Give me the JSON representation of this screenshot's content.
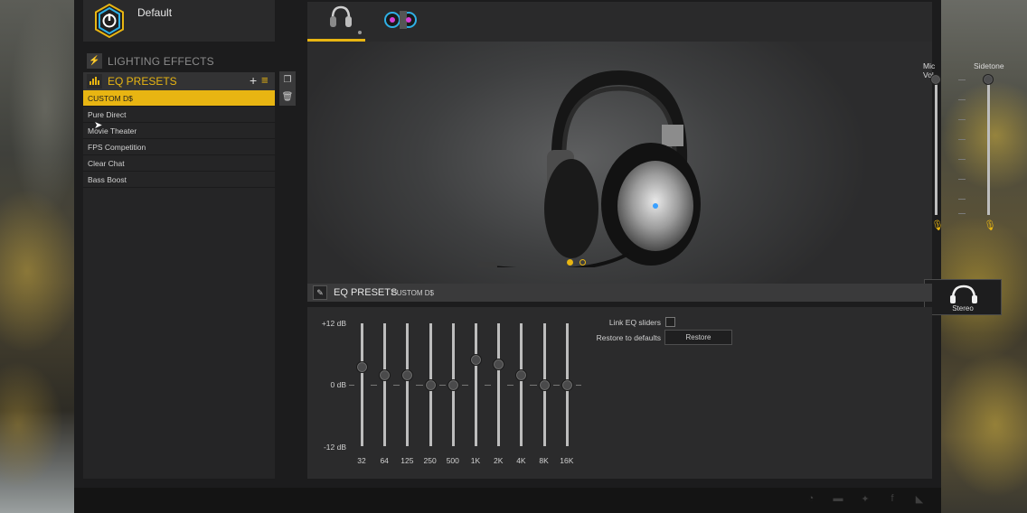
{
  "profile": {
    "name": "Default"
  },
  "sidebar": {
    "lighting_label": "LIGHTING EFFECTS",
    "eq_label": "EQ PRESETS",
    "add_glyph": "+",
    "menu_glyph": "≡",
    "presets": [
      "CUSTOM D$",
      "Pure Direct",
      "Movie Theater",
      "FPS Competition",
      "Clear Chat",
      "Bass Boost"
    ],
    "selected_index": 0
  },
  "hero": {
    "mic_vol_label": "Mic Vol",
    "sidetone_label": "Sidetone",
    "mic_vol_level": 1.0,
    "sidetone_level": 1.0,
    "stereo_label": "Stereo",
    "slide_count": 2,
    "active_slide": 0
  },
  "eq": {
    "title": "EQ PRESETS",
    "preset_name": "CUSTOM D$",
    "db_max": "+12 dB",
    "db_mid": "0 dB",
    "db_min": "-12 dB",
    "link_label": "Link EQ sliders",
    "link_checked": false,
    "restore_label": "Restore to defaults",
    "restore_button": "Restore",
    "bands": [
      {
        "label": "32",
        "gain_db": 3.5
      },
      {
        "label": "64",
        "gain_db": 2.0
      },
      {
        "label": "125",
        "gain_db": 2.0
      },
      {
        "label": "250",
        "gain_db": 0.0
      },
      {
        "label": "500",
        "gain_db": 0.0
      },
      {
        "label": "1K",
        "gain_db": 5.0
      },
      {
        "label": "2K",
        "gain_db": 4.0
      },
      {
        "label": "4K",
        "gain_db": 2.0
      },
      {
        "label": "8K",
        "gain_db": 0.0
      },
      {
        "label": "16K",
        "gain_db": 0.0
      }
    ]
  },
  "colors": {
    "accent": "#e8b512",
    "panel": "#2b2b2c",
    "background": "#1c1c1d"
  }
}
